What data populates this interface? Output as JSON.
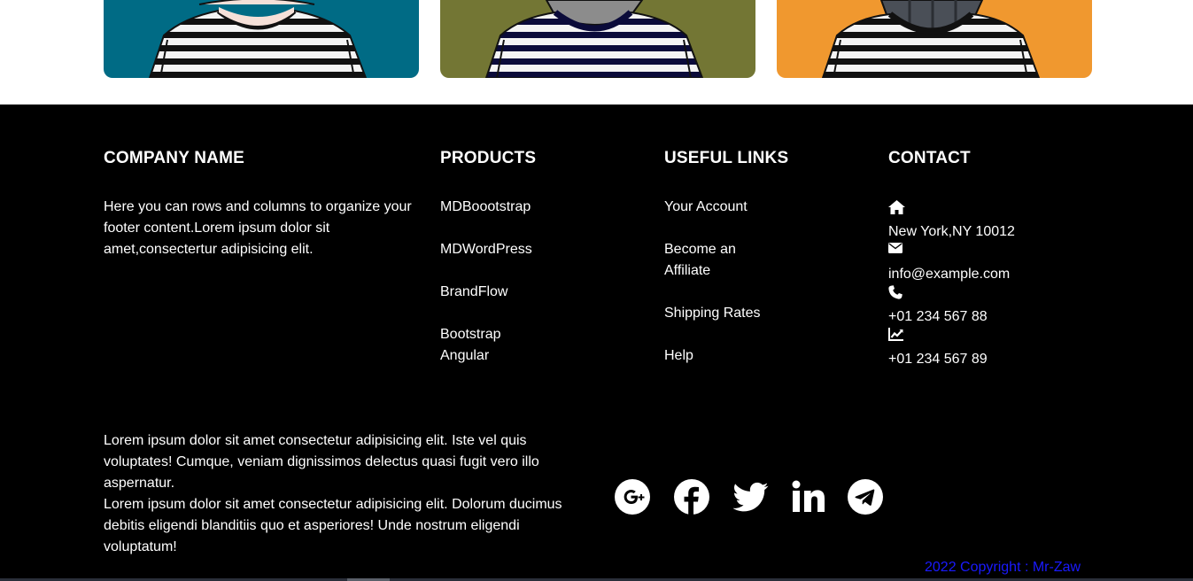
{
  "cards": [
    {
      "bg": "#006b85"
    },
    {
      "bg": "#737634"
    },
    {
      "bg": "#f0982f"
    }
  ],
  "footer": {
    "company": {
      "heading": "COMPANY NAME",
      "text": "Here you can rows and columns to organize your footer content.Lorem ipsum dolor sit amet,consectertur adipisicing elit."
    },
    "products": {
      "heading": "PRODUCTS",
      "items": [
        "MDBoootstrap",
        "MDWordPress",
        "BrandFlow",
        "Bootstrap Angular"
      ]
    },
    "useful_links": {
      "heading": "USEFUL LINKS",
      "items": [
        "Your Account",
        "Become an Affiliate",
        "Shipping Rates",
        "Help"
      ]
    },
    "contact": {
      "heading": "CONTACT",
      "items": [
        {
          "icon": "home-icon",
          "value": "New York,NY 10012"
        },
        {
          "icon": "envelope-icon",
          "value": "info@example.com"
        },
        {
          "icon": "phone-icon",
          "value": "+01 234 567 88"
        },
        {
          "icon": "chart-line-icon",
          "value": "+01 234 567 89"
        }
      ]
    },
    "about": {
      "p1": "Lorem ipsum dolor sit amet consectetur adipisicing elit. Iste vel quis voluptates! Cumque, veniam dignissimos delectus quasi fugit vero illo aspernatur.",
      "p2": "Lorem ipsum dolor sit amet consectetur adipisicing elit. Dolorum ducimus debitis eligendi blanditiis quo et asperiores! Unde nostrum eligendi voluptatum!"
    },
    "social": [
      "google-plus-icon",
      "facebook-icon",
      "twitter-icon",
      "linkedin-icon",
      "telegram-icon"
    ],
    "copyright": "2022 Copyright : Mr-Zaw"
  },
  "colors": {
    "copyright": "#1a1aff",
    "footer_bg": "#000000"
  }
}
